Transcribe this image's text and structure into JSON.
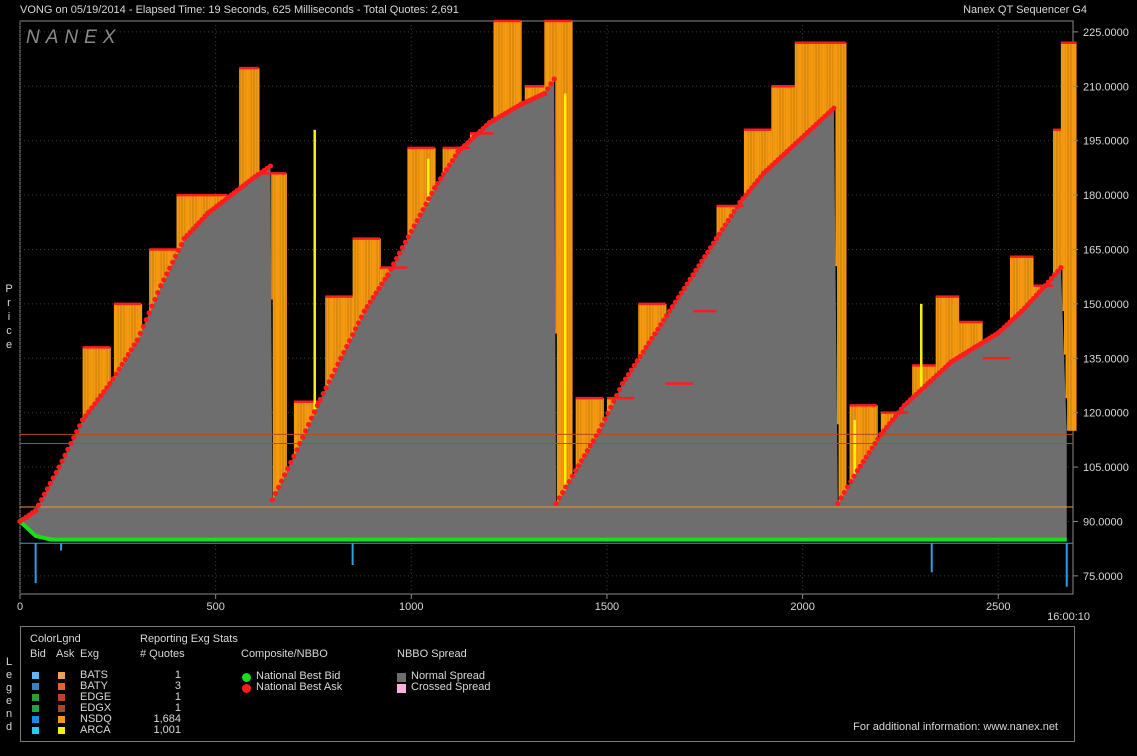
{
  "header": {
    "left_text": "VONG on 05/19/2014  -  Elapsed Time: 19 Seconds, 625 Milliseconds  -  Total Quotes: 2,691",
    "right_text": "Nanex QT Sequencer G4"
  },
  "watermark": "NANEX",
  "y_axis_title": [
    "P",
    "r",
    "i",
    "c",
    "e"
  ],
  "time_label": "16:00:10",
  "chart_data": {
    "type": "area",
    "xlim": [
      0,
      2691
    ],
    "ylim": [
      70,
      228
    ],
    "x_ticks": [
      0,
      500,
      1000,
      1500,
      2000,
      2500
    ],
    "x_tick_labels": [
      "0",
      "500",
      "1000",
      "1500",
      "2000",
      "2500"
    ],
    "y_ticks": [
      75,
      90,
      105,
      120,
      135,
      150,
      165,
      180,
      195,
      210,
      225
    ],
    "y_tick_labels": [
      "75.0000",
      "90.0000",
      "105.0000",
      "120.0000",
      "135.0000",
      "150.0000",
      "165.0000",
      "180.0000",
      "195.0000",
      "210.0000",
      "225.0000"
    ],
    "reference_lines": [
      {
        "y": 114.0,
        "color": "#b84a1e"
      },
      {
        "y": 111.5,
        "color": "#b84a1e"
      },
      {
        "y": 94.0,
        "color": "#e89a3a"
      },
      {
        "y": 84.0,
        "color": "#2aa0e0"
      }
    ],
    "series": [
      {
        "name": "National Best Ask",
        "color": "#ff1c1c",
        "points": [
          [
            0,
            90
          ],
          [
            40,
            93
          ],
          [
            100,
            105
          ],
          [
            160,
            118
          ],
          [
            230,
            128
          ],
          [
            300,
            140
          ],
          [
            360,
            155
          ],
          [
            420,
            168
          ],
          [
            480,
            175
          ],
          [
            540,
            180
          ],
          [
            600,
            185
          ],
          [
            640,
            188
          ],
          [
            645,
            96
          ],
          [
            700,
            108
          ],
          [
            760,
            122
          ],
          [
            820,
            135
          ],
          [
            880,
            148
          ],
          [
            940,
            158
          ],
          [
            1000,
            170
          ],
          [
            1060,
            182
          ],
          [
            1120,
            192
          ],
          [
            1200,
            200
          ],
          [
            1280,
            205
          ],
          [
            1340,
            208
          ],
          [
            1365,
            212
          ],
          [
            1370,
            95
          ],
          [
            1420,
            104
          ],
          [
            1480,
            115
          ],
          [
            1540,
            128
          ],
          [
            1600,
            138
          ],
          [
            1660,
            148
          ],
          [
            1720,
            158
          ],
          [
            1780,
            168
          ],
          [
            1840,
            178
          ],
          [
            1900,
            186
          ],
          [
            1960,
            192
          ],
          [
            2020,
            198
          ],
          [
            2080,
            204
          ],
          [
            2090,
            95
          ],
          [
            2140,
            104
          ],
          [
            2200,
            114
          ],
          [
            2260,
            122
          ],
          [
            2320,
            128
          ],
          [
            2380,
            134
          ],
          [
            2440,
            138
          ],
          [
            2500,
            142
          ],
          [
            2560,
            148
          ],
          [
            2620,
            155
          ],
          [
            2660,
            160
          ],
          [
            2675,
            115
          ]
        ]
      },
      {
        "name": "National Best Bid",
        "color": "#17e017",
        "points": [
          [
            0,
            90
          ],
          [
            40,
            86
          ],
          [
            80,
            85
          ],
          [
            2675,
            85
          ]
        ]
      }
    ],
    "ask_peaks": [
      [
        160,
        138
      ],
      [
        240,
        150
      ],
      [
        330,
        165
      ],
      [
        400,
        180
      ],
      [
        460,
        180
      ],
      [
        560,
        215
      ],
      [
        610,
        186
      ],
      [
        700,
        123
      ],
      [
        780,
        152
      ],
      [
        850,
        168
      ],
      [
        920,
        160
      ],
      [
        990,
        193
      ],
      [
        1080,
        193
      ],
      [
        1150,
        197
      ],
      [
        1210,
        228
      ],
      [
        1290,
        210
      ],
      [
        1340,
        228
      ],
      [
        1420,
        124
      ],
      [
        1500,
        124
      ],
      [
        1580,
        150
      ],
      [
        1650,
        128
      ],
      [
        1720,
        148
      ],
      [
        1780,
        177
      ],
      [
        1850,
        198
      ],
      [
        1920,
        210
      ],
      [
        1980,
        222
      ],
      [
        2040,
        222
      ],
      [
        2120,
        122
      ],
      [
        2200,
        120
      ],
      [
        2280,
        133
      ],
      [
        2340,
        152
      ],
      [
        2400,
        145
      ],
      [
        2460,
        135
      ],
      [
        2530,
        163
      ],
      [
        2590,
        155
      ],
      [
        2640,
        198
      ],
      [
        2660,
        222
      ]
    ],
    "yellow_spikes": [
      [
        750,
        198
      ],
      [
        1040,
        190
      ],
      [
        1390,
        208
      ],
      [
        1460,
        112
      ],
      [
        2080,
        190
      ],
      [
        2130,
        118
      ],
      [
        2300,
        150
      ]
    ],
    "blue_dips": [
      [
        40,
        73
      ],
      [
        105,
        82
      ],
      [
        850,
        78
      ],
      [
        2330,
        76
      ],
      [
        2675,
        72
      ]
    ]
  },
  "legend": {
    "side_title": [
      "L",
      "e",
      "g",
      "e",
      "n",
      "d"
    ],
    "col_colorlgnd": "ColorLgnd",
    "col_bid": "Bid",
    "col_ask": "Ask",
    "col_exg": "Exg",
    "stats_title": "Reporting Exg Stats",
    "stats_sub": "# Quotes",
    "exchanges": [
      {
        "name": "BATS",
        "quotes": "1",
        "bid_color": "#5cb8f0",
        "ask_color": "#f0a050"
      },
      {
        "name": "BATY",
        "quotes": "3",
        "bid_color": "#3a80c8",
        "ask_color": "#e86030"
      },
      {
        "name": "EDGE",
        "quotes": "1",
        "bid_color": "#2e9a3a",
        "ask_color": "#c0402a"
      },
      {
        "name": "EDGX",
        "quotes": "1",
        "bid_color": "#25a045",
        "ask_color": "#a04a2a"
      },
      {
        "name": "NSDQ",
        "quotes": "1,684",
        "bid_color": "#1a8ae8",
        "ask_color": "#f59a10"
      },
      {
        "name": "ARCA",
        "quotes": "1,001",
        "bid_color": "#20d0f0",
        "ask_color": "#f4f400"
      }
    ],
    "composite_title": "Composite/NBBO",
    "composite": [
      {
        "label": "National Best Bid",
        "color": "#17e017"
      },
      {
        "label": "National Best Ask",
        "color": "#ff1c1c"
      }
    ],
    "spread_title": "NBBO Spread",
    "spread": [
      {
        "label": "Normal Spread",
        "color": "#6e6e6e"
      },
      {
        "label": "Crossed Spread",
        "color": "#ffb0e0"
      }
    ],
    "footer": "For additional information: www.nanex.net"
  }
}
